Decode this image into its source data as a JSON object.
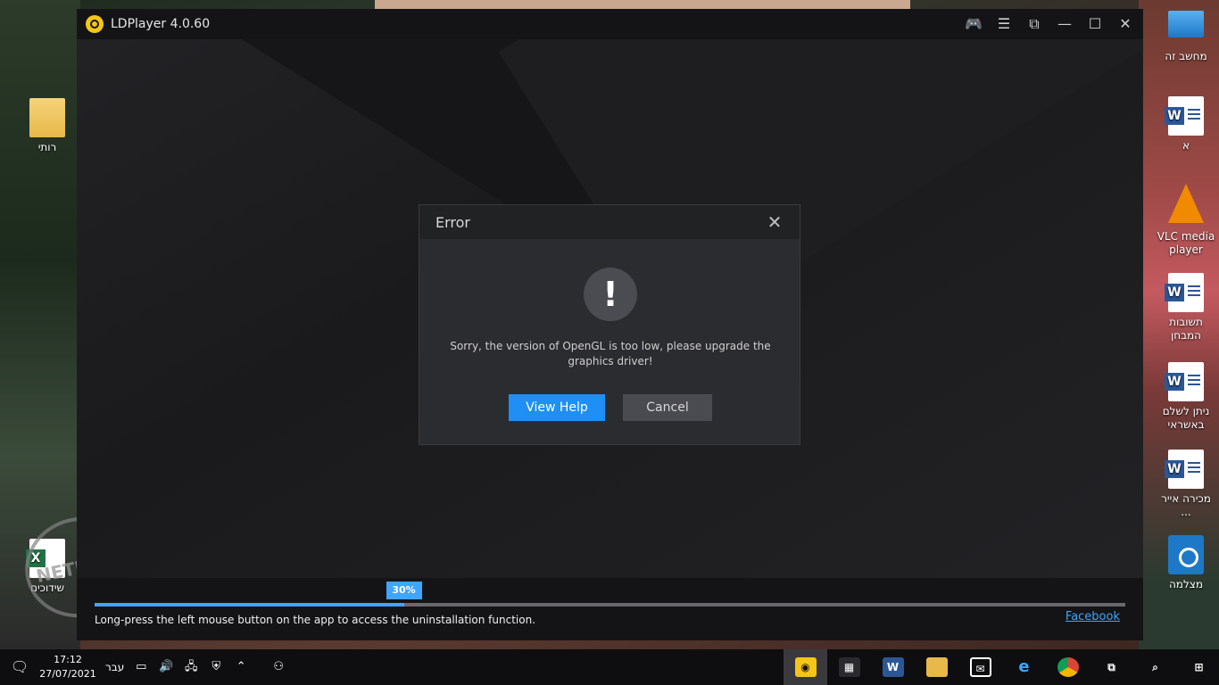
{
  "desktop": {
    "icons_left": [
      {
        "label": "רותי",
        "icon": "folder-icon"
      },
      {
        "label": "שידוכים",
        "icon": "excel-icon"
      }
    ],
    "icons_right": [
      {
        "label": "מחשב זה",
        "icon": "computer-icon"
      },
      {
        "label": "א",
        "icon": "word-icon"
      },
      {
        "label": "VLC media player",
        "icon": "vlc-icon"
      },
      {
        "label": "תשובות המבחן",
        "icon": "word-icon"
      },
      {
        "label": "ניתן לשלם באשראי",
        "icon": "word-icon"
      },
      {
        "label": "מכירה אייר ...",
        "icon": "word-icon"
      },
      {
        "label": "מצלמה",
        "icon": "camera-icon"
      }
    ],
    "watermark": "NETFREE"
  },
  "ldplayer": {
    "title": "LDPlayer 4.0.60",
    "progress": {
      "percent": 30,
      "label": "30%"
    },
    "tip": "Long-press the left mouse button on the app to access the uninstallation function.",
    "link": "Facebook"
  },
  "dialog": {
    "title": "Error",
    "close": "✕",
    "icon": "!",
    "message": "Sorry, the version of OpenGL is too low, please upgrade the graphics driver!",
    "primary_label": "View Help",
    "secondary_label": "Cancel"
  },
  "taskbar": {
    "time": "17:12",
    "date": "27/07/2021",
    "language": "עבר",
    "notification_count": "1"
  },
  "colors": {
    "accent": "#1f8ff5",
    "progress": "#3ea6ff",
    "ld_brand": "#f5c518"
  }
}
